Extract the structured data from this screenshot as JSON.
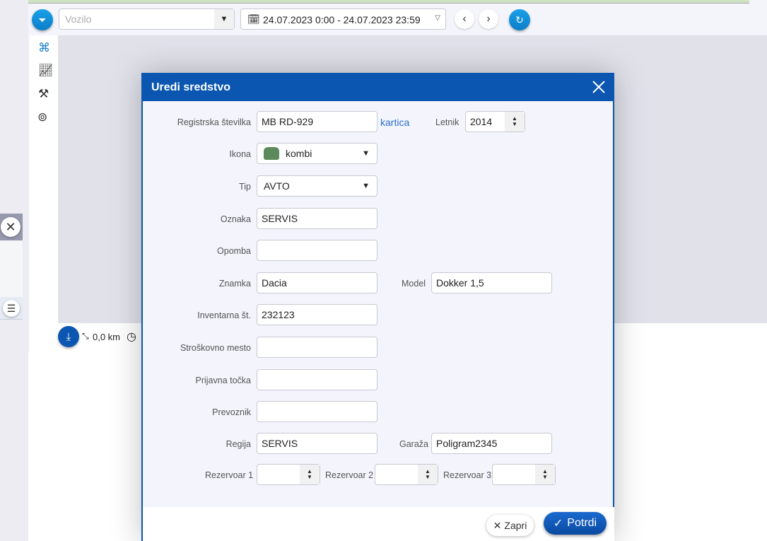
{
  "toolbar": {
    "vehicle_placeholder": "Vozilo",
    "date_range": "24.07.2023 0:00 - 24.07.2023 23:59"
  },
  "bottombar": {
    "distance": "0,0 km"
  },
  "dialog": {
    "title": "Uredi sredstvo",
    "fields": {
      "registrska": {
        "label": "Registrska številka",
        "value": "MB RD-929"
      },
      "kartica_link": "kartica",
      "letnik": {
        "label": "Letnik",
        "value": "2014"
      },
      "ikona": {
        "label": "Ikona",
        "value": "kombi"
      },
      "tip": {
        "label": "Tip",
        "value": "AVTO"
      },
      "oznaka": {
        "label": "Oznaka",
        "value": "SERVIS"
      },
      "opomba": {
        "label": "Opomba",
        "value": ""
      },
      "znamka": {
        "label": "Znamka",
        "value": "Dacia"
      },
      "model": {
        "label": "Model",
        "value": "Dokker 1,5"
      },
      "inventarna": {
        "label": "Inventarna št.",
        "value": "232123"
      },
      "stroskovno": {
        "label": "Stroškovno mesto",
        "value": ""
      },
      "prijavna": {
        "label": "Prijavna točka",
        "value": ""
      },
      "prevoznik": {
        "label": "Prevoznik",
        "value": ""
      },
      "regija": {
        "label": "Regija",
        "value": "SERVIS"
      },
      "garaza": {
        "label": "Garaža",
        "value": "Poligram2345"
      },
      "rez1": {
        "label": "Rezervoar 1",
        "value": ""
      },
      "rez2": {
        "label": "Rezervoar 2",
        "value": ""
      },
      "rez3": {
        "label": "Rezervoar 3",
        "value": ""
      }
    },
    "close_label": "Zapri",
    "confirm_label": "Potrdi"
  },
  "colors": {
    "accent": "#0a56b0",
    "button_blue": "#1a9be0",
    "link": "#2a6fd0"
  }
}
